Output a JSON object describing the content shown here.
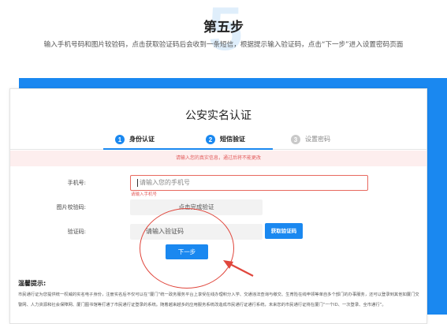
{
  "header": {
    "step_number": "5",
    "title": "第五步",
    "description": "输入手机号码和图片较验码，点击获取验证码后会收到一条短信，根据提示输入验证码，点击“下一步”进入设置密码页面"
  },
  "card": {
    "title": "公安实名认证",
    "steps": [
      {
        "number": "1",
        "label": "身份认证",
        "state": "active"
      },
      {
        "number": "2",
        "label": "短信验证",
        "state": "active"
      },
      {
        "number": "3",
        "label": "设置密码",
        "state": "inactive"
      }
    ],
    "notice": "请输入您的真实信息，通过后将不能更改",
    "form": {
      "phone_label": "手机号:",
      "phone_placeholder": "请输入您的手机号",
      "phone_error": "请输入手机号",
      "captcha_label": "图片校验码:",
      "captcha_text": "点击完成验证",
      "code_label": "验证码:",
      "code_placeholder": "请输入验证码",
      "get_code_button": "获取验证码",
      "next_button": "下一步"
    },
    "tips": {
      "title": "温馨提示:",
      "text": "市民通行证为您提供统一权威的实名电子身份，注册实名后不仅可以在“厦门”统一政务服务平台上享受在线办理积分入学、交通违法查询与缴交、生育险在线申领等单自多个部门的办事服务，还可以登录到其他如厦门交警网、人力资源和社会保障网、厦门图书馆等打通了市民通行证登录的系统。随着越来越多的应用服务系统改造成市民通行证通行系统，未来您的市民通行证将在厦门“一个ID、一次登录、全市通行”。"
    }
  },
  "colors": {
    "accent": "#1a88f0",
    "error": "#e25b5b",
    "annotation": "#e0463c"
  }
}
